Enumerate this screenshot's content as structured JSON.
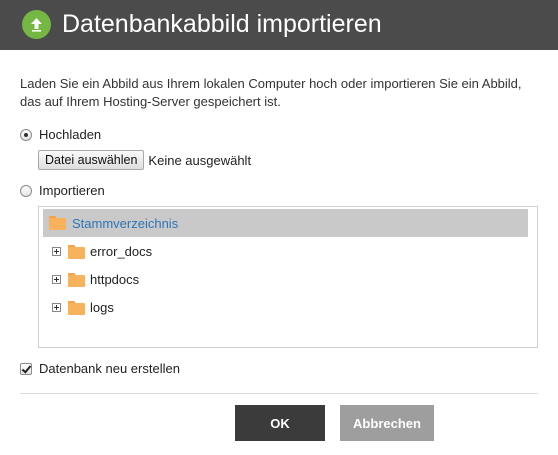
{
  "dialog": {
    "title": "Datenbankabbild importieren",
    "header_icon": "upload-arrow-icon",
    "description": "Laden Sie ein Abbild aus Ihrem lokalen Computer hoch oder importieren Sie ein Abbild, das auf Ihrem Hosting-Server gespeichert ist."
  },
  "options": {
    "upload": {
      "label": "Hochladen",
      "selected": true
    },
    "file_button_label": "Datei auswählen",
    "file_status": "Keine ausgewählt",
    "import": {
      "label": "Importieren",
      "selected": false
    }
  },
  "tree": {
    "root": {
      "label": "Stammverzeichnis",
      "selected": true
    },
    "items": [
      {
        "label": "error_docs"
      },
      {
        "label": "httpdocs"
      },
      {
        "label": "logs"
      }
    ]
  },
  "recreate_db": {
    "label": "Datenbank neu erstellen",
    "checked": true
  },
  "buttons": {
    "ok": "OK",
    "cancel": "Abbrechen"
  },
  "colors": {
    "header_bg": "#4b4b4b",
    "header_icon": "#74b843",
    "folder": "#f8b25c",
    "root_selected_bg": "#c9c9c9",
    "root_label": "#2e75b6",
    "ok_button": "#3b3b3b",
    "cancel_button": "#9e9e9e"
  }
}
